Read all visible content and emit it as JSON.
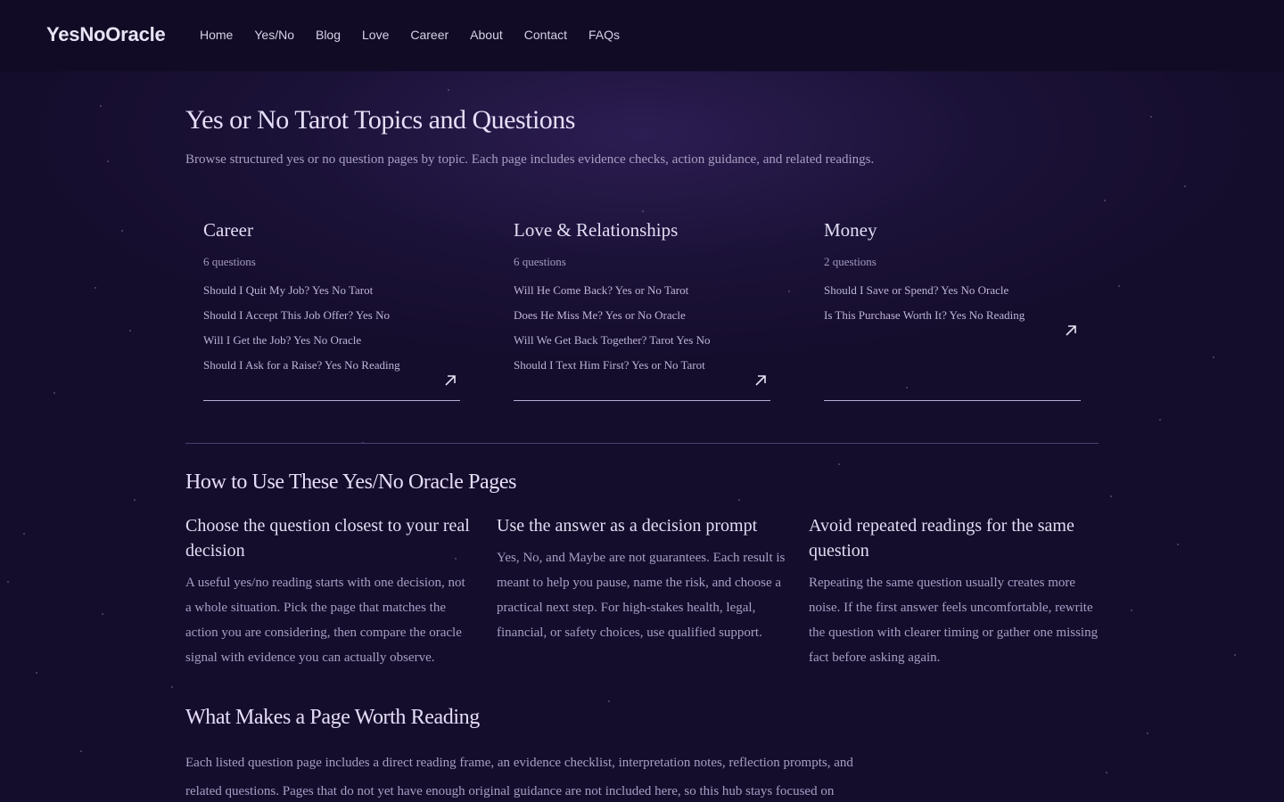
{
  "header": {
    "logo": "YesNoOracle",
    "nav": [
      "Home",
      "Yes/No",
      "Blog",
      "Love",
      "Career",
      "About",
      "Contact",
      "FAQs"
    ]
  },
  "hero": {
    "title": "Yes or No Tarot Topics and Questions",
    "intro": "Browse structured yes or no question pages by topic. Each page includes evidence checks, action guidance, and related readings."
  },
  "topics": [
    {
      "name": "Career",
      "count": "6 questions",
      "links": [
        "Should I Quit My Job? Yes No Tarot",
        "Should I Accept This Job Offer? Yes No",
        "Will I Get the Job? Yes No Oracle",
        "Should I Ask for a Raise? Yes No Reading"
      ]
    },
    {
      "name": "Love & Relationships",
      "count": "6 questions",
      "links": [
        "Will He Come Back? Yes or No Tarot",
        "Does He Miss Me? Yes or No Oracle",
        "Will We Get Back Together? Tarot Yes No",
        "Should I Text Him First? Yes or No Tarot"
      ]
    },
    {
      "name": "Money",
      "count": "2 questions",
      "links": [
        "Should I Save or Spend? Yes No Oracle",
        "Is This Purchase Worth It? Yes No Reading"
      ]
    }
  ],
  "howto": {
    "title": "How to Use These Yes/No Oracle Pages",
    "columns": [
      {
        "heading": "Choose the question closest to your real decision",
        "body": "A useful yes/no reading starts with one decision, not a whole situation. Pick the page that matches the action you are considering, then compare the oracle signal with evidence you can actually observe."
      },
      {
        "heading": "Use the answer as a decision prompt",
        "body": "Yes, No, and Maybe are not guarantees. Each result is meant to help you pause, name the risk, and choose a practical next step. For high-stakes health, legal, financial, or safety choices, use qualified support."
      },
      {
        "heading": "Avoid repeated readings for the same question",
        "body": "Repeating the same question usually creates more noise. If the first answer feels uncomfortable, rewrite the question with clearer timing or gather one missing fact before asking again."
      }
    ]
  },
  "worth": {
    "title": "What Makes a Page Worth Reading",
    "body": "Each listed question page includes a direct reading frame, an evidence checklist, interpretation notes, reflection prompts, and related questions. Pages that do not yet have enough original guidance are not included here, so this hub stays focused on"
  },
  "icons": {
    "topic_arrow": "arrow-up-right-icon"
  },
  "colors": {
    "background": "#170f30",
    "header": "#120b25",
    "accent_text": "#e6def8"
  }
}
